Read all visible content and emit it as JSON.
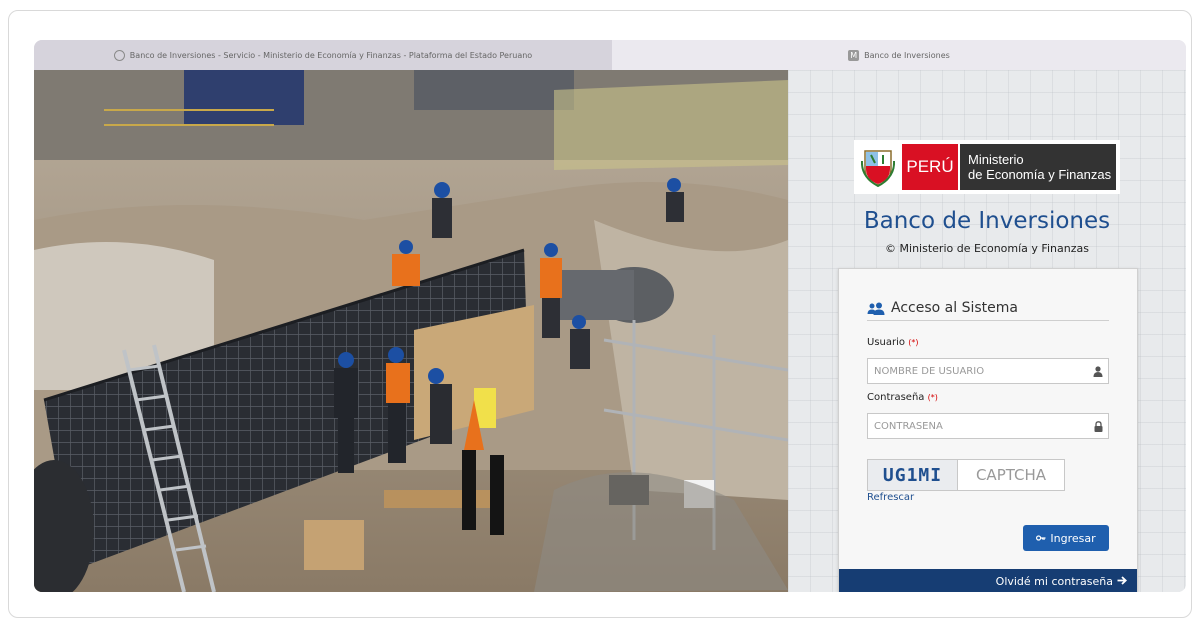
{
  "tabs": [
    {
      "label": "Banco de Inversiones - Servicio - Ministerio de Economía y Finanzas - Plataforma del Estado Peruano",
      "active": true
    },
    {
      "label": "Banco de Inversiones",
      "active": false
    }
  ],
  "logo": {
    "country": "PERÚ",
    "line1": "Ministerio",
    "line2": "de Economía y Finanzas"
  },
  "app": {
    "title": "Banco de Inversiones",
    "subtitle": "© Ministerio de Economía y Finanzas"
  },
  "login": {
    "header": "Acceso al Sistema",
    "user_label": "Usuario",
    "user_placeholder": "NOMBRE DE USUARIO",
    "pass_label": "Contraseña",
    "pass_placeholder": "CONTRASEÑA",
    "required_mark": "(*)",
    "captcha_code": "UG1MI",
    "captcha_placeholder": "CAPTCHA",
    "refresh_label": "Refrescar",
    "submit_label": "Ingresar",
    "forgot_label": "Olvidé mi contraseña"
  },
  "colors": {
    "brand_blue": "#1f4f8f",
    "button_blue": "#1f5fae",
    "footer_navy": "#163d73",
    "peru_red": "#d91023"
  }
}
